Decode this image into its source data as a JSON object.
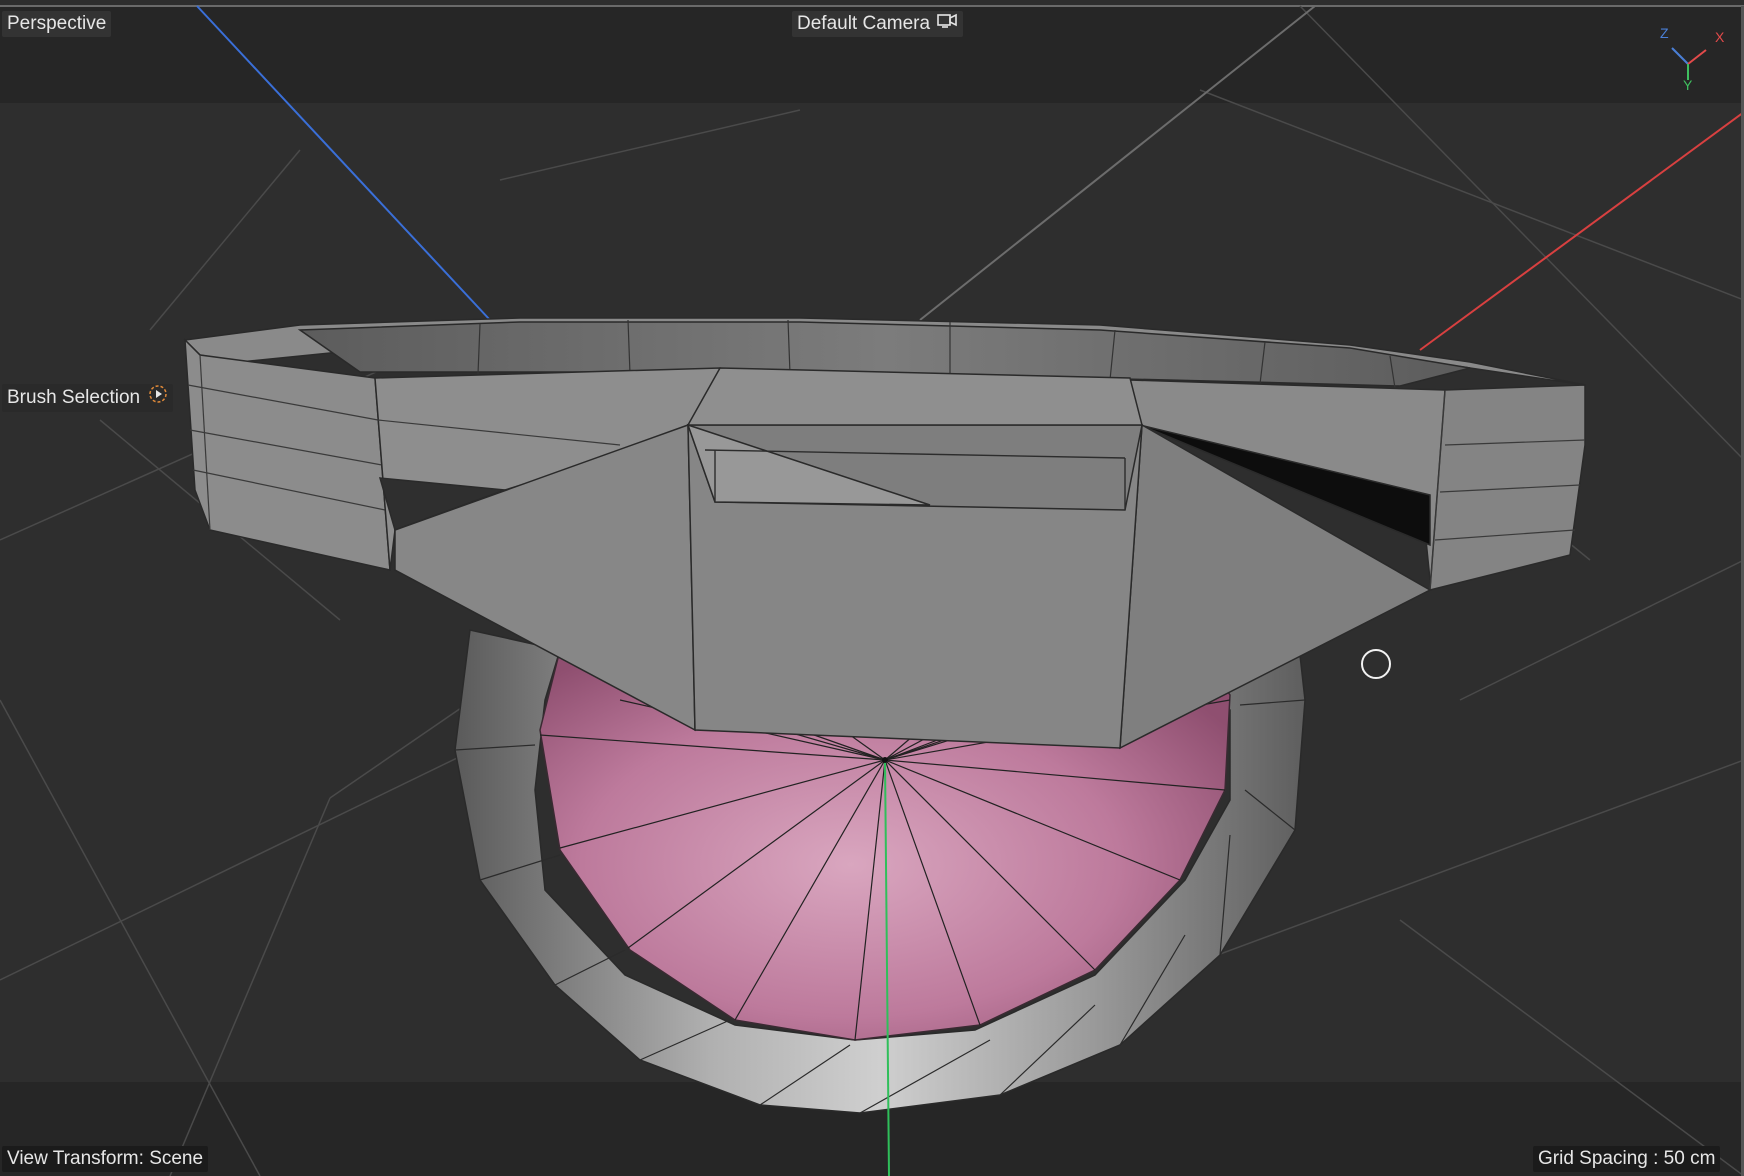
{
  "viewport": {
    "view_name": "Perspective",
    "camera_name": "Default Camera",
    "camera_icon": "camera-switch-icon",
    "tool_name": "Brush Selection",
    "tool_icon": "play-circle-icon",
    "view_transform": "View Transform: Scene",
    "grid_spacing": "Grid Spacing : 50 cm"
  },
  "axis_gizmo": {
    "z_label": "Z",
    "x_label": "X",
    "y_label": "Y",
    "z_color": "#4a7fd6",
    "x_color": "#e24a4a",
    "y_color": "#3fbf5f"
  },
  "colors": {
    "background": "#2e2e2e",
    "band": "#262626",
    "mesh_gray": "#8a8a8a",
    "mesh_pink": "#c07a9a",
    "accent_orange": "#e08a3a"
  }
}
